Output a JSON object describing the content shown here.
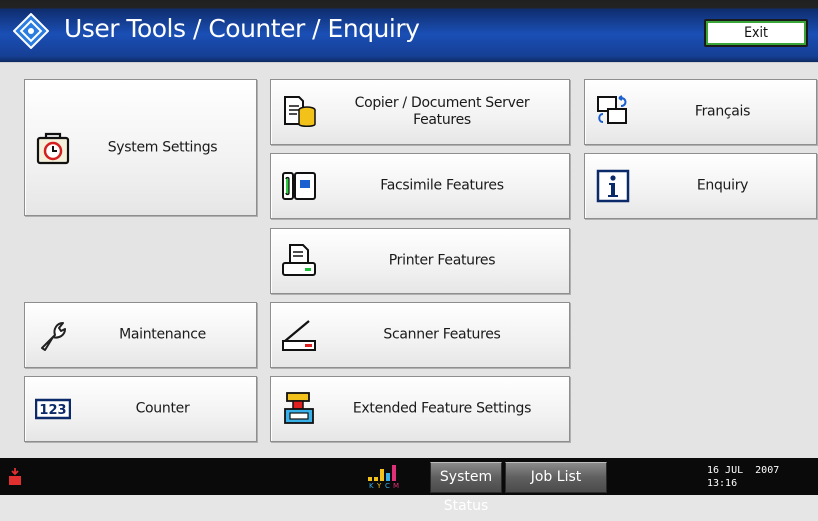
{
  "header": {
    "title": "User Tools / Counter / Enquiry",
    "exit_label": "Exit"
  },
  "left_column": {
    "system_settings": "System Settings",
    "maintenance": "Maintenance",
    "counter": "Counter"
  },
  "middle_column": {
    "copier_line1": "Copier / Document Server",
    "copier_line2": "Features",
    "facsimile": "Facsimile Features",
    "printer": "Printer Features",
    "scanner": "Scanner Features",
    "extended": "Extended Feature Settings"
  },
  "right_column": {
    "language": "Français",
    "enquiry": "Enquiry"
  },
  "footer": {
    "system_status": "System Status",
    "job_list": "Job List",
    "date": "16 JUL  2007",
    "time": "13:16",
    "kycm_letters": [
      "K",
      "Y",
      "C",
      "M"
    ]
  },
  "icons": {
    "logo": "diamond-logo-icon",
    "system_settings": "alarm-clock-icon",
    "maintenance": "wrench-icon",
    "counter": "counter-123-icon",
    "copier": "document-server-icon",
    "facsimile": "fax-icon",
    "printer": "printer-icon",
    "scanner": "scanner-icon",
    "extended": "extended-settings-icon",
    "language": "language-switch-icon",
    "enquiry": "info-icon",
    "toner": "toner-warning-icon"
  },
  "colors": {
    "header_blue": "#1a4fb5",
    "exit_outline": "#3aa63a",
    "background": "#e4e4e4",
    "footer": "#0a0a0a"
  }
}
